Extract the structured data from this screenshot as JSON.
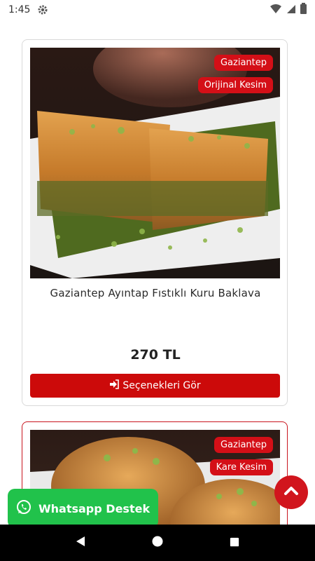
{
  "status_bar": {
    "time": "1:45",
    "icons": [
      "gear-icon",
      "wifi-icon",
      "signal-icon",
      "battery-icon"
    ]
  },
  "products": [
    {
      "badges": [
        "Gaziantep",
        "Orijinal Kesim"
      ],
      "title": "Gaziantep Ayıntap Fıstıklı Kuru Baklava",
      "price": "270 TL",
      "button_label": "Seçenekleri Gör",
      "button_icon": "sign-in-icon"
    },
    {
      "badges": [
        "Gaziantep",
        "Kare Kesim"
      ]
    }
  ],
  "whatsapp": {
    "label": "Whatsapp Destek",
    "icon": "whatsapp-icon",
    "color": "#21c24b"
  },
  "scroll_top": {
    "icon": "chevron-up-icon"
  },
  "navigation": {
    "buttons": [
      "back-icon",
      "home-icon",
      "recents-icon"
    ]
  },
  "colors": {
    "accent_red": "#cc0a0a",
    "badge_red": "#d40f17",
    "whatsapp_green": "#21c24b"
  }
}
